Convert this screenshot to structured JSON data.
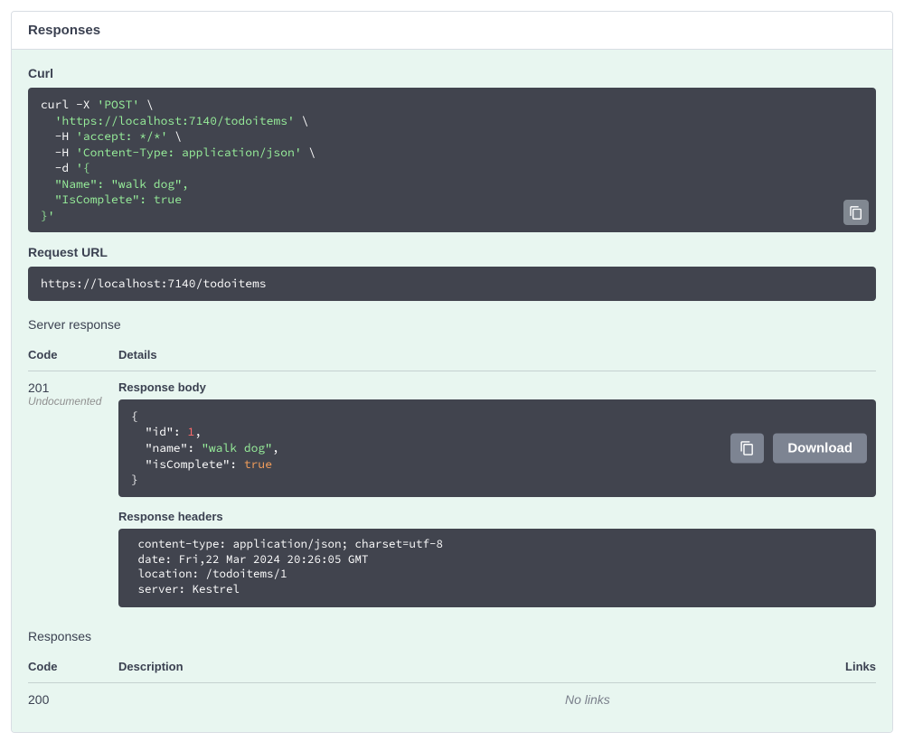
{
  "header": {
    "title": "Responses"
  },
  "curl": {
    "label": "Curl",
    "p1": "curl -X ",
    "s1": "'POST'",
    "p2": " \\\n  ",
    "s2": "'https://localhost:7140/todoitems'",
    "p3": " \\\n  -H ",
    "s3": "'accept: */*'",
    "p4": " \\\n  -H ",
    "s4": "'Content-Type: application/json'",
    "p5": " \\\n  -d ",
    "s5a": "'{\n  \"Name\": \"walk dog\",\n  \"IsComplete\": true\n}'"
  },
  "request_url": {
    "label": "Request URL",
    "value": "https://localhost:7140/todoitems"
  },
  "server_response": {
    "label": "Server response",
    "col_code": "Code",
    "col_details": "Details",
    "code": "201",
    "undocumented": "Undocumented",
    "body_label": "Response body",
    "body": {
      "lbrace": "{",
      "l1k": "\"id\"",
      "l1sep": ": ",
      "l1v": "1",
      "l2k": "\"name\"",
      "l2sep": ": ",
      "l2v": "\"walk dog\"",
      "l3k": "\"isComplete\"",
      "l3sep": ": ",
      "l3v": "true",
      "rbrace": "}",
      "comma": ","
    },
    "download": "Download",
    "headers_label": "Response headers",
    "headers_text": " content-type: application/json; charset=utf-8 \n date: Fri,22 Mar 2024 20:26:05 GMT \n location: /todoitems/1 \n server: Kestrel "
  },
  "responses2": {
    "label": "Responses",
    "col_code": "Code",
    "col_desc": "Description",
    "col_links": "Links",
    "row_code": "200",
    "row_links": "No links"
  }
}
